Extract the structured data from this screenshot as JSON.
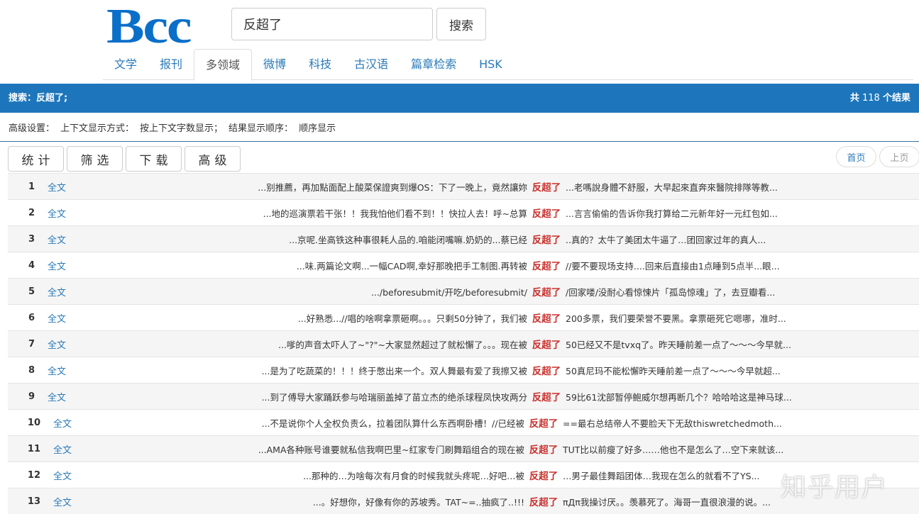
{
  "logo": "Bcc",
  "search": {
    "value": "反超了",
    "button": "搜索"
  },
  "tabs": [
    "文学",
    "报刊",
    "多领域",
    "微博",
    "科技",
    "古汉语",
    "篇章检索",
    "HSK"
  ],
  "active_tab": 2,
  "bar": {
    "query": "搜索：反超了;",
    "count_prefix": "共",
    "count": "118",
    "count_suffix": "个结果"
  },
  "advanced": {
    "label": "高级设置：",
    "context_mode_label": "上下文显示方式：",
    "context_mode": "按上下文字数显示；",
    "order_label": "结果显示顺序：",
    "order": "顺序显示"
  },
  "toolbar": [
    "统计",
    "筛选",
    "下载",
    "高级"
  ],
  "pager": {
    "first": "首页",
    "prev": "上页"
  },
  "keyword": "反超了",
  "link_label": "全文",
  "rows": [
    {
      "n": "1",
      "left": "...别推薦，再加點面配上酸菜保證爽到爆OS：下了一晚上，竟然讓妳",
      "right": "...老嗎說身體不舒服，大早起來直奔來醫院排隊等教..."
    },
    {
      "n": "2",
      "left": "...地的巡演票若干张！！我我怕他们看不到！！快拉人去！呼~总算",
      "right": "...言言偷偷的告诉你我打算给二元新年好一元红包如..."
    },
    {
      "n": "3",
      "left": "...京呢.坐高铁这种事很耗人品的.咱能闭嘴嘛.奶奶的...蔡已经",
      "right": "..真的？太牛了美团太牛逼了…团回家过年的真人..."
    },
    {
      "n": "4",
      "left": "...味.两篇论文啊...一幅CAD啊,幸好那晚把手工制图.再转被",
      "right": "//要不要现场支持....回来后直接由1点睡到5点半...眼..."
    },
    {
      "n": "5",
      "left": ".../beforesubmit/开吃/beforesubmit/",
      "right": "/回家喽/没耐心看惊悚片「孤岛惊魂」了，去豆瓣看..."
    },
    {
      "n": "6",
      "left": "...好熟悉...//唱的啥啊拿票砸啊。。。只剩50分钟了，我们被",
      "right": "200多票，我们要荣誉不要黑。拿票砸死它嗯哪，准时..."
    },
    {
      "n": "7",
      "left": "...嗲的声音太吓人了~\"?\"~大家显然超过了就松懈了。。。现在被",
      "right": "50已经又不是tvxq了。昨天睡前差一点了～～～今早就..."
    },
    {
      "n": "8",
      "left": "...是为了吃蔬菜的！！！终于憋出来一个。双人舞最有爱了我擦又被",
      "right": "50真尼玛不能松懈昨天睡前差一点了～～～今早就超..."
    },
    {
      "n": "9",
      "left": "...到了傅导大家踊跃参与哈瑞丽盖掉了苗立杰的绝杀球程凤快攻两分",
      "right": "59比61沈部暂停鲍威尔想再断几个？哈哈哈这是神马球..."
    },
    {
      "n": "10",
      "left": "...不是说你个人全权负责么，拉着团队算什么东西啊卧槽！//已经被",
      "right": "==最右总结帝人不要脸天下无敌thiswretchedmoth..."
    },
    {
      "n": "11",
      "left": "...AMA各种账号谁要就私信我啊巴里~红家专门刷舞蹈组合的现在被",
      "right": "TUT比以前瘦了好多……他也不是怎么了…空下来就该..."
    },
    {
      "n": "12",
      "left": "...那种的…为啥每次有月食的时候我就头疼呢…好吧…被",
      "right": "…男子最佳舞蹈团体…我现在怎么的就看不了YS..."
    },
    {
      "n": "13",
      "left": "...。好想你，好像有你的苏坡秀。TAT~=..抽疯了..!!!",
      "right": "πДπ我操讨厌。。羡慕死了。海哥一直很浪漫的说。..."
    }
  ],
  "watermark": "知乎用户"
}
